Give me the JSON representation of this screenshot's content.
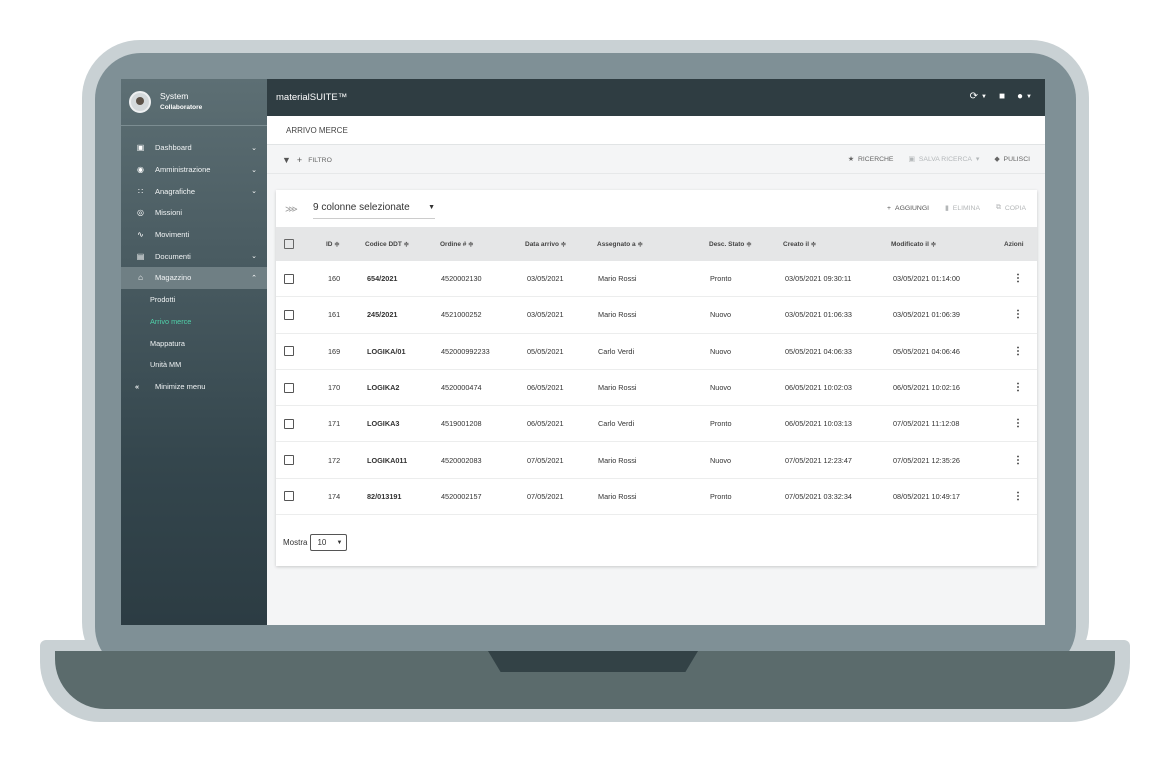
{
  "sidebar": {
    "user_name": "System",
    "user_role": "Collaboratore",
    "items": [
      {
        "label": "Dashboard",
        "icon": "dashboard-icon",
        "glyph": "▣",
        "chevron": "⌄"
      },
      {
        "label": "Amministrazione",
        "icon": "lock-icon",
        "glyph": "🔒",
        "chevron": "⌄"
      },
      {
        "label": "Anagrafiche",
        "icon": "users-icon",
        "glyph": "👥",
        "chevron": "⌄"
      },
      {
        "label": "Missioni",
        "icon": "target-icon",
        "glyph": "◎",
        "chevron": ""
      },
      {
        "label": "Movimenti",
        "icon": "forklift-icon",
        "glyph": "⛟",
        "chevron": ""
      },
      {
        "label": "Documenti",
        "icon": "document-icon",
        "glyph": "▤",
        "chevron": "⌄"
      },
      {
        "label": "Magazzino",
        "icon": "warehouse-icon",
        "glyph": "⌂",
        "chevron": "⌃"
      }
    ],
    "subitems": [
      "Prodotti",
      "Arrivo merce",
      "Mappatura",
      "Unità MM"
    ],
    "current_subitem": "Arrivo merce",
    "minimize_label": "Minimize menu",
    "minimize_glyph": "«"
  },
  "topbar": {
    "title": "materialSUITE™",
    "icons": [
      "refresh-icon",
      "chat-icon",
      "user-icon"
    ]
  },
  "breadcrumb": "ARRIVO MERCE",
  "filterbar": {
    "filter_label": "FILTRO",
    "ricerche_label": "RICERCHE",
    "salva_label": "SALVA RICERCA",
    "pulisci_label": "PULISCI"
  },
  "toolbar": {
    "columns_selected": "9 colonne selezionate",
    "add_label": "AGGIUNGI",
    "delete_label": "ELIMINA",
    "copy_label": "COPIA"
  },
  "table": {
    "headers": [
      "ID ≑",
      "Codice DDT ≑",
      "Ordine # ≑",
      "Data arrivo ≑",
      "Assegnato a ≑",
      "Desc. Stato ≑",
      "Creato il ≑",
      "Modificato il ≑",
      "Azioni"
    ],
    "rows": [
      [
        "160",
        "654/2021",
        "4520002130",
        "03/05/2021",
        "Mario Rossi",
        "Pronto",
        "03/05/2021 09:30:11",
        "03/05/2021 01:14:00"
      ],
      [
        "161",
        "245/2021",
        "4521000252",
        "03/05/2021",
        "Mario Rossi",
        "Nuovo",
        "03/05/2021 01:06:33",
        "03/05/2021 01:06:39"
      ],
      [
        "169",
        "LOGIKA/01",
        "452000992233",
        "05/05/2021",
        "Carlo Verdi",
        "Nuovo",
        "05/05/2021 04:06:33",
        "05/05/2021 04:06:46"
      ],
      [
        "170",
        "LOGIKA2",
        "4520000474",
        "06/05/2021",
        "Mario Rossi",
        "Nuovo",
        "06/05/2021 10:02:03",
        "06/05/2021 10:02:16"
      ],
      [
        "171",
        "LOGIKA3",
        "4519001208",
        "06/05/2021",
        "Carlo Verdi",
        "Pronto",
        "06/05/2021 10:03:13",
        "07/05/2021 11:12:08"
      ],
      [
        "172",
        "LOGIKA011",
        "4520002083",
        "07/05/2021",
        "Mario Rossi",
        "Nuovo",
        "07/05/2021 12:23:47",
        "07/05/2021 12:35:26"
      ],
      [
        "174",
        "82/013191",
        "4520002157",
        "07/05/2021",
        "Mario Rossi",
        "Pronto",
        "07/05/2021 03:32:34",
        "08/05/2021 10:49:17"
      ]
    ]
  },
  "pagination": {
    "show_label": "Mostra",
    "page_size": "10"
  },
  "colors": {
    "accent_green": "#4fd1a9",
    "topbar": "#2f3d42"
  }
}
